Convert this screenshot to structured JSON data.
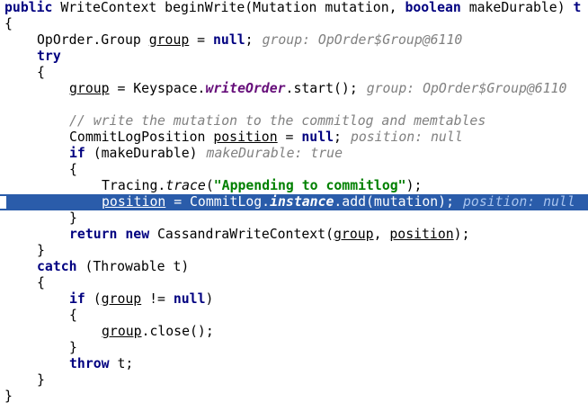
{
  "editor": {
    "current_line_index": 12,
    "lines": [
      {
        "indent": 0,
        "tokens": [
          {
            "t": "public",
            "c": "kw"
          },
          {
            "t": " WriteContext beginWrite(Mutation mutation, "
          },
          {
            "t": "boolean",
            "c": "kw"
          },
          {
            "t": " makeDurable) "
          },
          {
            "t": "t",
            "c": "kw"
          }
        ]
      },
      {
        "indent": 0,
        "tokens": [
          {
            "t": "{"
          }
        ]
      },
      {
        "indent": 1,
        "tokens": [
          {
            "t": "OpOrder.Group "
          },
          {
            "t": "group",
            "c": "u"
          },
          {
            "t": " = "
          },
          {
            "t": "null",
            "c": "kw"
          },
          {
            "t": ";"
          },
          {
            "t": "group: OpOrder$Group@6110",
            "c": "inl"
          }
        ]
      },
      {
        "indent": 1,
        "tokens": [
          {
            "t": "try",
            "c": "kw"
          }
        ]
      },
      {
        "indent": 1,
        "tokens": [
          {
            "t": "{"
          }
        ]
      },
      {
        "indent": 2,
        "tokens": [
          {
            "t": "group",
            "c": "u"
          },
          {
            "t": " = Keyspace."
          },
          {
            "t": "writeOrder",
            "c": "mpurple"
          },
          {
            "t": ".start();"
          },
          {
            "t": "group: OpOrder$Group@6110",
            "c": "inl"
          }
        ]
      },
      {
        "indent": 0,
        "tokens": []
      },
      {
        "indent": 2,
        "tokens": [
          {
            "t": "// write the mutation to the commitlog and memtables",
            "c": "cmt"
          }
        ]
      },
      {
        "indent": 2,
        "tokens": [
          {
            "t": "CommitLogPosition "
          },
          {
            "t": "position",
            "c": "u"
          },
          {
            "t": " = "
          },
          {
            "t": "null",
            "c": "kw"
          },
          {
            "t": ";"
          },
          {
            "t": "position: null",
            "c": "inl"
          }
        ]
      },
      {
        "indent": 2,
        "tokens": [
          {
            "t": "if",
            "c": "kw"
          },
          {
            "t": " (makeDurable)"
          },
          {
            "t": "makeDurable: true",
            "c": "inl"
          }
        ]
      },
      {
        "indent": 2,
        "tokens": [
          {
            "t": "{"
          }
        ]
      },
      {
        "indent": 3,
        "tokens": [
          {
            "t": "Tracing."
          },
          {
            "t": "trace",
            "c": "ital"
          },
          {
            "t": "("
          },
          {
            "t": "\"Appending to commitlog\"",
            "c": "str"
          },
          {
            "t": ");"
          }
        ]
      },
      {
        "indent": 3,
        "tokens": [
          {
            "t": "position",
            "c": "u"
          },
          {
            "t": " = CommitLog."
          },
          {
            "t": "instance",
            "c": "boldit"
          },
          {
            "t": ".add(mutation);"
          },
          {
            "t": "position: null",
            "c": "inl"
          }
        ]
      },
      {
        "indent": 2,
        "tokens": [
          {
            "t": "}"
          }
        ]
      },
      {
        "indent": 2,
        "tokens": [
          {
            "t": "return",
            "c": "kw"
          },
          {
            "t": " "
          },
          {
            "t": "new",
            "c": "kw"
          },
          {
            "t": " CassandraWriteContext("
          },
          {
            "t": "group",
            "c": "u"
          },
          {
            "t": ", "
          },
          {
            "t": "position",
            "c": "u"
          },
          {
            "t": ");"
          }
        ]
      },
      {
        "indent": 1,
        "tokens": [
          {
            "t": "}"
          }
        ]
      },
      {
        "indent": 1,
        "tokens": [
          {
            "t": "catch",
            "c": "kw"
          },
          {
            "t": " (Throwable t)"
          }
        ]
      },
      {
        "indent": 1,
        "tokens": [
          {
            "t": "{"
          }
        ]
      },
      {
        "indent": 2,
        "tokens": [
          {
            "t": "if",
            "c": "kw"
          },
          {
            "t": " ("
          },
          {
            "t": "group",
            "c": "u"
          },
          {
            "t": " != "
          },
          {
            "t": "null",
            "c": "kw"
          },
          {
            "t": ")"
          }
        ]
      },
      {
        "indent": 2,
        "tokens": [
          {
            "t": "{"
          }
        ]
      },
      {
        "indent": 3,
        "tokens": [
          {
            "t": "group",
            "c": "u"
          },
          {
            "t": ".close();"
          }
        ]
      },
      {
        "indent": 2,
        "tokens": [
          {
            "t": "}"
          }
        ]
      },
      {
        "indent": 2,
        "tokens": [
          {
            "t": "throw",
            "c": "kw"
          },
          {
            "t": " t;"
          }
        ]
      },
      {
        "indent": 1,
        "tokens": [
          {
            "t": "}"
          }
        ]
      },
      {
        "indent": 0,
        "tokens": [
          {
            "t": "}"
          }
        ]
      }
    ]
  },
  "colors": {
    "keyword": "#000080",
    "string": "#008000",
    "comment": "#808080",
    "field": "#660e7a",
    "current_line": "#2a5caa",
    "background": "#ffffff"
  }
}
